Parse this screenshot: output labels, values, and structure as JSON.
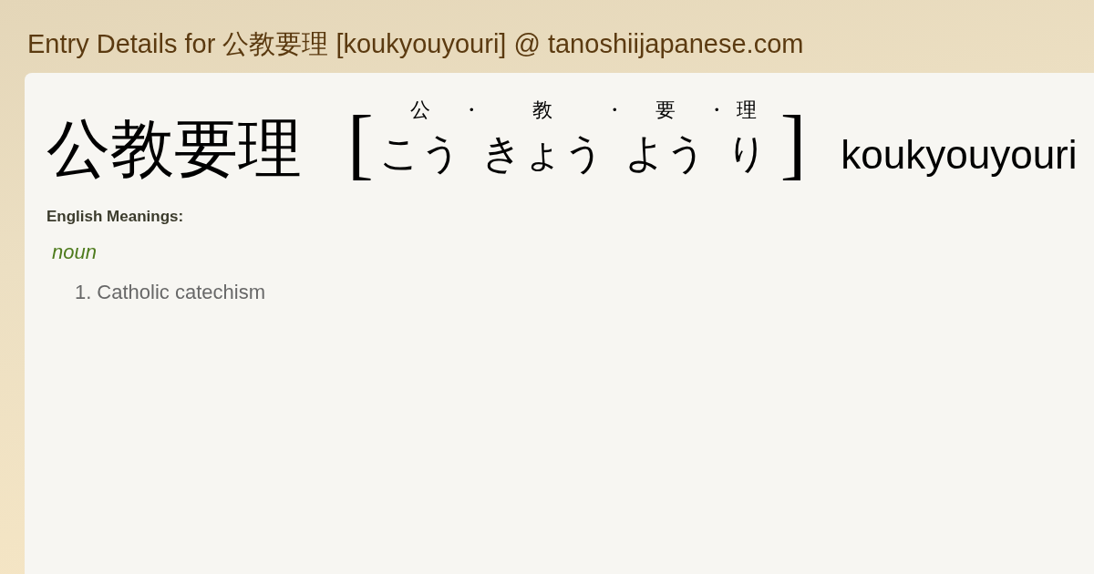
{
  "header": {
    "title": "Entry Details for 公教要理 [koukyouyouri] @ tanoshiijapanese.com"
  },
  "entry": {
    "word": "公教要理",
    "open_bracket": "[",
    "reading": [
      {
        "kind": "group",
        "kanji": "公",
        "kana": "こう"
      },
      {
        "kind": "separator",
        "text": "・"
      },
      {
        "kind": "group",
        "kanji": "教",
        "kana": "きょう"
      },
      {
        "kind": "separator",
        "text": "・"
      },
      {
        "kind": "group",
        "kanji": "要",
        "kana": "よう"
      },
      {
        "kind": "separator",
        "text": "・"
      },
      {
        "kind": "group",
        "kanji": "理",
        "kana": "り"
      }
    ],
    "close_bracket": "]",
    "romaji": "koukyouyouri"
  },
  "meanings": {
    "heading": "English Meanings:",
    "sections": [
      {
        "part_of_speech": "noun",
        "senses": [
          {
            "number": "1.",
            "text": "Catholic catechism"
          }
        ]
      }
    ]
  }
}
